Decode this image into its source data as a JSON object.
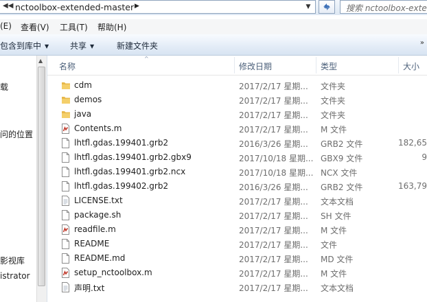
{
  "address": {
    "path": "nctoolbox-extended-master",
    "search_placeholder": "搜索 nctoolbox-exte"
  },
  "menu": [
    "(E)",
    "查看(V)",
    "工具(T)",
    "帮助(H)"
  ],
  "commands": {
    "include_in_library": "包含到库中",
    "share": "共享",
    "new_folder": "新建文件夹"
  },
  "nav": [
    {
      "label": "下载",
      "display": "下载"
    },
    {
      "label": "最近访问的位置",
      "display": "问的位置"
    },
    {
      "label": "影视库",
      "display": "影视库"
    },
    {
      "label": "Administrator",
      "display": "istrator"
    }
  ],
  "columns": {
    "name": "名称",
    "date": "修改日期",
    "type": "类型",
    "size": "大小"
  },
  "files": [
    {
      "name": "cdm",
      "date": "2017/2/17 星期...",
      "type": "文件夹",
      "size": "",
      "icon": "folder-icon"
    },
    {
      "name": "demos",
      "date": "2017/2/17 星期...",
      "type": "文件夹",
      "size": "",
      "icon": "folder-icon"
    },
    {
      "name": "java",
      "date": "2017/2/17 星期...",
      "type": "文件夹",
      "size": "",
      "icon": "folder-icon"
    },
    {
      "name": "Contents.m",
      "date": "2017/2/17 星期...",
      "type": "M 文件",
      "size": "",
      "icon": "matlab-file-icon"
    },
    {
      "name": "lhtfl.gdas.199401.grb2",
      "date": "2016/3/26 星期...",
      "type": "GRB2 文件",
      "size": "182,65",
      "icon": "file-icon"
    },
    {
      "name": "lhtfl.gdas.199401.grb2.gbx9",
      "date": "2017/10/18 星期...",
      "type": "GBX9 文件",
      "size": "9",
      "icon": "file-icon"
    },
    {
      "name": "lhtfl.gdas.199401.grb2.ncx",
      "date": "2017/10/18 星期...",
      "type": "NCX 文件",
      "size": "",
      "icon": "file-icon"
    },
    {
      "name": "lhtfl.gdas.199402.grb2",
      "date": "2016/3/26 星期...",
      "type": "GRB2 文件",
      "size": "163,79",
      "icon": "file-icon"
    },
    {
      "name": "LICENSE.txt",
      "date": "2017/2/17 星期...",
      "type": "文本文档",
      "size": "",
      "icon": "text-file-icon"
    },
    {
      "name": "package.sh",
      "date": "2017/2/17 星期...",
      "type": "SH 文件",
      "size": "",
      "icon": "file-icon"
    },
    {
      "name": "readfile.m",
      "date": "2017/2/17 星期...",
      "type": "M 文件",
      "size": "",
      "icon": "matlab-file-icon"
    },
    {
      "name": "README",
      "date": "2017/2/17 星期...",
      "type": "文件",
      "size": "",
      "icon": "file-icon"
    },
    {
      "name": "README.md",
      "date": "2017/2/17 星期...",
      "type": "MD 文件",
      "size": "",
      "icon": "file-icon"
    },
    {
      "name": "setup_nctoolbox.m",
      "date": "2017/2/17 星期...",
      "type": "M 文件",
      "size": "",
      "icon": "matlab-file-icon"
    },
    {
      "name": "声明.txt",
      "date": "2017/2/17 星期...",
      "type": "文本文档",
      "size": "",
      "icon": "text-file-icon"
    }
  ],
  "colors": {
    "folder": "#e8b84a",
    "accent": "#4c607a",
    "matlab": "#c0392b"
  }
}
